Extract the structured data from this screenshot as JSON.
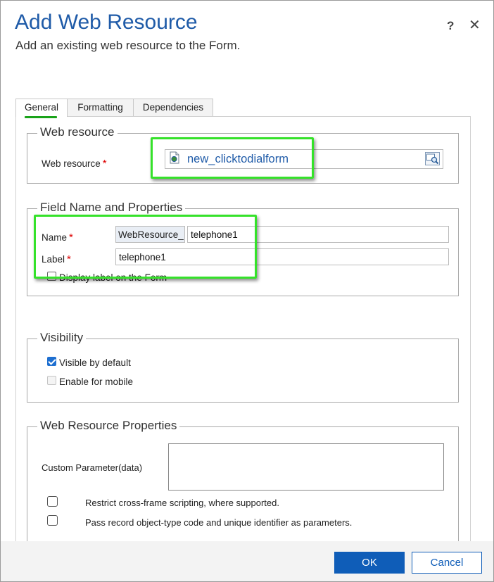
{
  "dialog": {
    "title": "Add Web Resource",
    "subtitle": "Add an existing web resource to the Form.",
    "help_label": "?",
    "close_label": "✕"
  },
  "tabs": [
    {
      "label": "General",
      "active": true
    },
    {
      "label": "Formatting",
      "active": false
    },
    {
      "label": "Dependencies",
      "active": false
    }
  ],
  "web_resource_section": {
    "title": "Web resource",
    "field_label": "Web resource",
    "required_mark": "*",
    "value": "new_clicktodialform",
    "icons": {
      "file": "web-resource-file-icon",
      "lookup": "lookup-search-icon"
    }
  },
  "field_section": {
    "title": "Field Name and Properties",
    "name_label": "Name",
    "name_required": "*",
    "name_prefix": "WebResource_",
    "name_value": "telephone1",
    "label_label": "Label",
    "label_required": "*",
    "label_value": "telephone1",
    "display_label_text": "Display label on the Form",
    "display_label_checked": false
  },
  "visibility_section": {
    "title": "Visibility",
    "visible_default_label": "Visible by default",
    "visible_default_checked": true,
    "enable_mobile_label": "Enable for mobile",
    "enable_mobile_checked": false
  },
  "properties_section": {
    "title": "Web Resource Properties",
    "custom_param_label": "Custom Parameter(data)",
    "custom_param_value": "",
    "restrict_label": "Restrict cross-frame scripting, where supported.",
    "pass_record_label": "Pass record object-type code and unique identifier as parameters."
  },
  "footer": {
    "ok_label": "OK",
    "cancel_label": "Cancel"
  },
  "colors": {
    "title_blue": "#1f5ba8",
    "primary_button": "#0f5db8",
    "highlight_green": "#35e22a",
    "required_red": "#dd0000"
  }
}
